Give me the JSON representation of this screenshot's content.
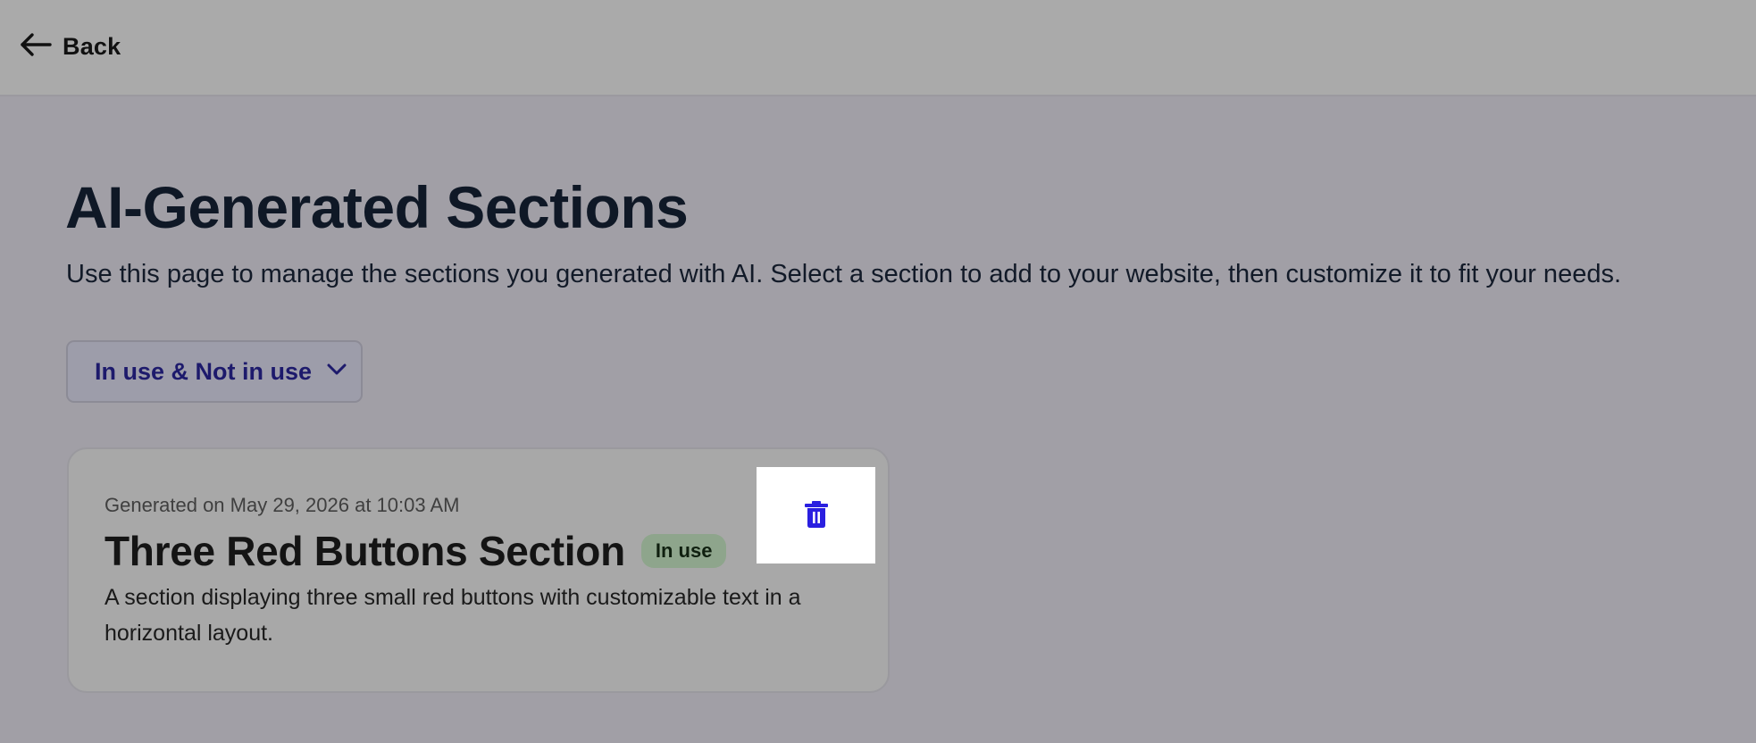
{
  "header": {
    "back_label": "Back",
    "back_icon": "arrow-left-icon"
  },
  "page": {
    "title": "AI-Generated Sections",
    "description": "Use this page to manage the sections you generated with AI. Select a section to add to your website, then customize it to fit your needs."
  },
  "filter": {
    "selected": "In use & Not in use",
    "icon": "chevron-down-icon"
  },
  "sections": [
    {
      "generated_on": "Generated on May 29, 2026 at 10:03 AM",
      "title": "Three Red Buttons Section",
      "status": "In use",
      "description": "A section displaying three small red buttons with customizable text in a horizontal layout.",
      "delete_icon": "trash-icon"
    }
  ],
  "colors": {
    "background": "#a19fa6",
    "topbar": "#aaaaaa",
    "dropdown_text": "#1d1a6c",
    "badge_bg": "#8ea58c",
    "delete_icon": "#2a1fe0"
  }
}
